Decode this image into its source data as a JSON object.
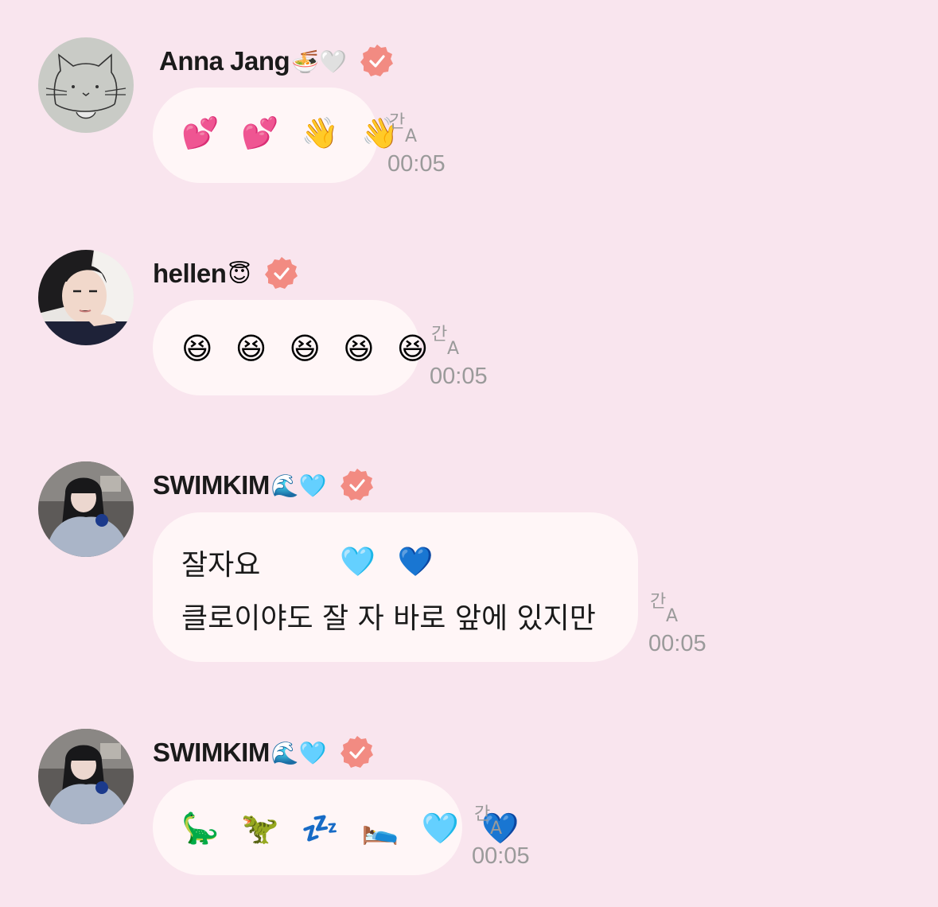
{
  "messages": [
    {
      "sender": "Anna Jang",
      "sender_emoji": "🍜🤍",
      "verified": true,
      "lines": [
        "💕 💕 👋 👋"
      ],
      "translate_icon": "translate-icon",
      "time": "00:05"
    },
    {
      "sender": "hellen",
      "sender_emoji": "😇",
      "verified": true,
      "lines": [
        "😆 😆 😆 😆 😆"
      ],
      "translate_icon": "translate-icon",
      "time": "00:05"
    },
    {
      "sender": "SWIMKIM",
      "sender_emoji": "🌊🩵",
      "verified": true,
      "lines": [
        "잘자요",
        "🩵 💙",
        "클로이야도 잘 자 바로 앞에 있지만"
      ],
      "translate_icon": "translate-icon",
      "time": "00:05"
    },
    {
      "sender": "SWIMKIM",
      "sender_emoji": "🌊🩵",
      "verified": true,
      "lines": [
        "🦕 🦖 💤 🛌 🩵 💙"
      ],
      "translate_icon": "translate-icon",
      "time": "00:05"
    }
  ],
  "colors": {
    "background": "#f9e5ee",
    "bubble": "#fff6f7",
    "verified_badge": "#f28b82",
    "timestamp": "#9a9a9a"
  }
}
